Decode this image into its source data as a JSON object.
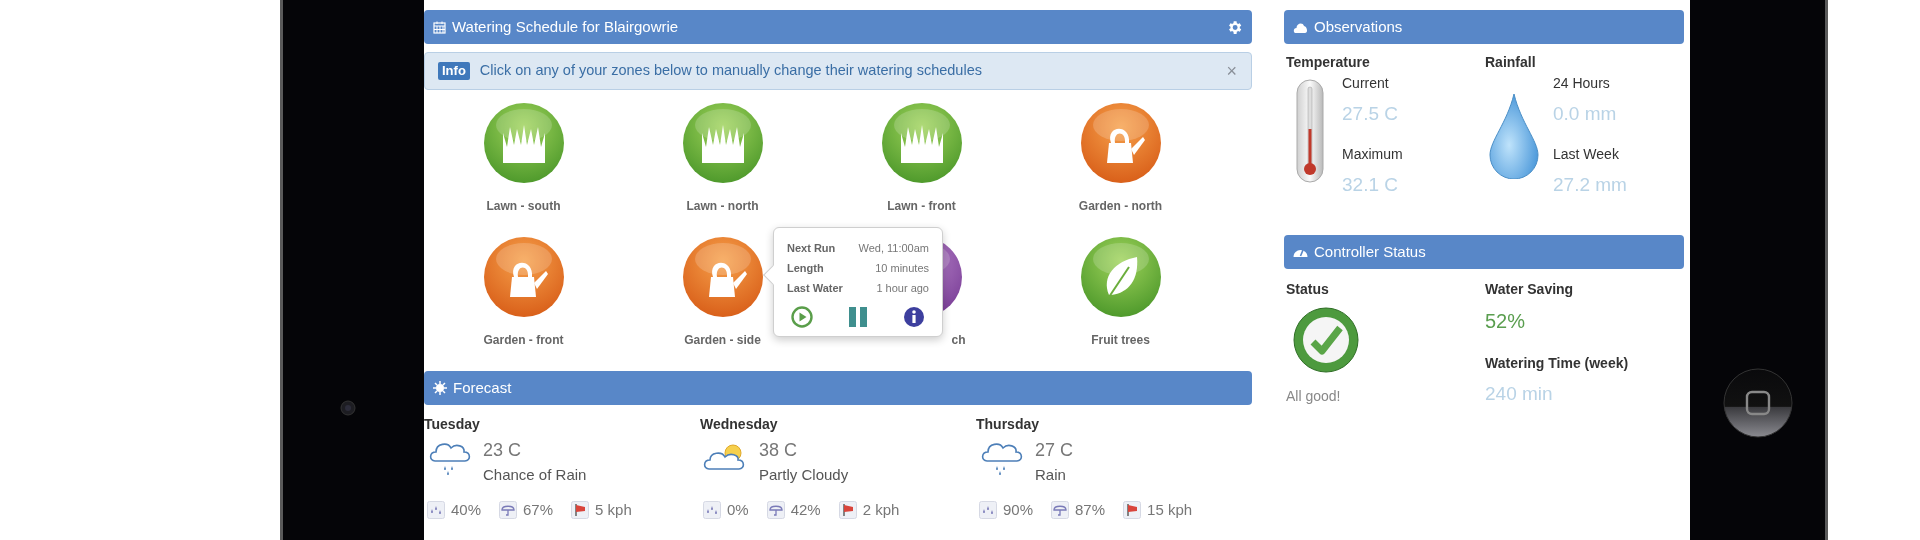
{
  "schedule": {
    "title": "Watering Schedule for Blairgowrie",
    "info": {
      "badge": "Info",
      "message": "Click on any of your zones below to manually change their watering schedules",
      "close": "×"
    },
    "zones": [
      {
        "label": "Lawn - south",
        "kind": "lawn"
      },
      {
        "label": "Lawn - north",
        "kind": "lawn"
      },
      {
        "label": "Lawn - front",
        "kind": "lawn"
      },
      {
        "label": "Garden - north",
        "kind": "garden"
      },
      {
        "label": "Garden - front",
        "kind": "garden"
      },
      {
        "label": "Garden - side",
        "kind": "garden",
        "popover": {
          "rows": [
            {
              "label": "Next Run",
              "value": "Wed, 11:00am"
            },
            {
              "label": "Length",
              "value": "10 minutes"
            },
            {
              "label": "Last Water",
              "value": "1 hour ago"
            }
          ]
        }
      },
      {
        "label": "ch",
        "kind": "other",
        "covered": true
      },
      {
        "label": "Fruit trees",
        "kind": "tree"
      }
    ]
  },
  "forecast": {
    "title": "Forecast",
    "days": [
      {
        "name": "Tuesday",
        "temp": "23 C",
        "summary": "Chance of Rain",
        "kind": "rain",
        "rain": "40%",
        "humidity": "67%",
        "wind": "5 kph"
      },
      {
        "name": "Wednesday",
        "temp": "38 C",
        "summary": "Partly Cloudy",
        "kind": "partly_cloudy",
        "rain": "0%",
        "humidity": "42%",
        "wind": "2 kph"
      },
      {
        "name": "Thursday",
        "temp": "27 C",
        "summary": "Rain",
        "kind": "rain",
        "rain": "90%",
        "humidity": "87%",
        "wind": "15 kph"
      }
    ]
  },
  "observations": {
    "title": "Observations",
    "temperature": {
      "label": "Temperature",
      "current_label": "Current",
      "current": "27.5 C",
      "max_label": "Maximum",
      "max": "32.1 C"
    },
    "rainfall": {
      "label": "Rainfall",
      "day_label": "24 Hours",
      "day": "0.0 mm",
      "week_label": "Last Week",
      "week": "27.2 mm"
    }
  },
  "controller": {
    "title": "Controller Status",
    "status_label": "Status",
    "ok": true,
    "status_text": "All good!",
    "saving_label": "Water Saving",
    "saving": "52%",
    "time_label": "Watering Time (week)",
    "time": "240 min"
  }
}
